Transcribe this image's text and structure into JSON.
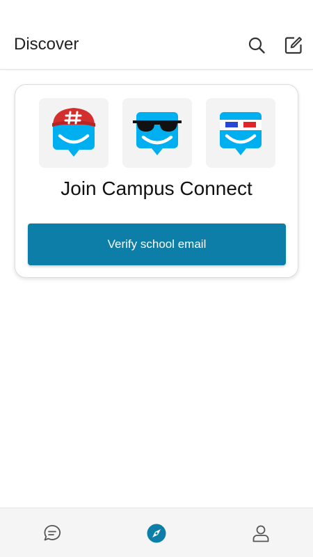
{
  "header": {
    "title": "Discover",
    "search_icon": "search-icon",
    "compose_icon": "compose-icon"
  },
  "card": {
    "avatars": [
      "groupme-cap-avatar",
      "groupme-sunglasses-avatar",
      "groupme-3d-glasses-avatar"
    ],
    "title": "Join Campus Connect",
    "button_label": "Verify school email"
  },
  "bottom_nav": {
    "items": [
      {
        "icon": "chat-bubble-icon",
        "active": false
      },
      {
        "icon": "compass-icon",
        "active": true
      },
      {
        "icon": "profile-icon",
        "active": false
      }
    ]
  },
  "colors": {
    "accent": "#0c7ea8",
    "avatar_blue": "#00aff0",
    "cap_red": "#d42f2f",
    "nav_inactive": "#555555"
  }
}
